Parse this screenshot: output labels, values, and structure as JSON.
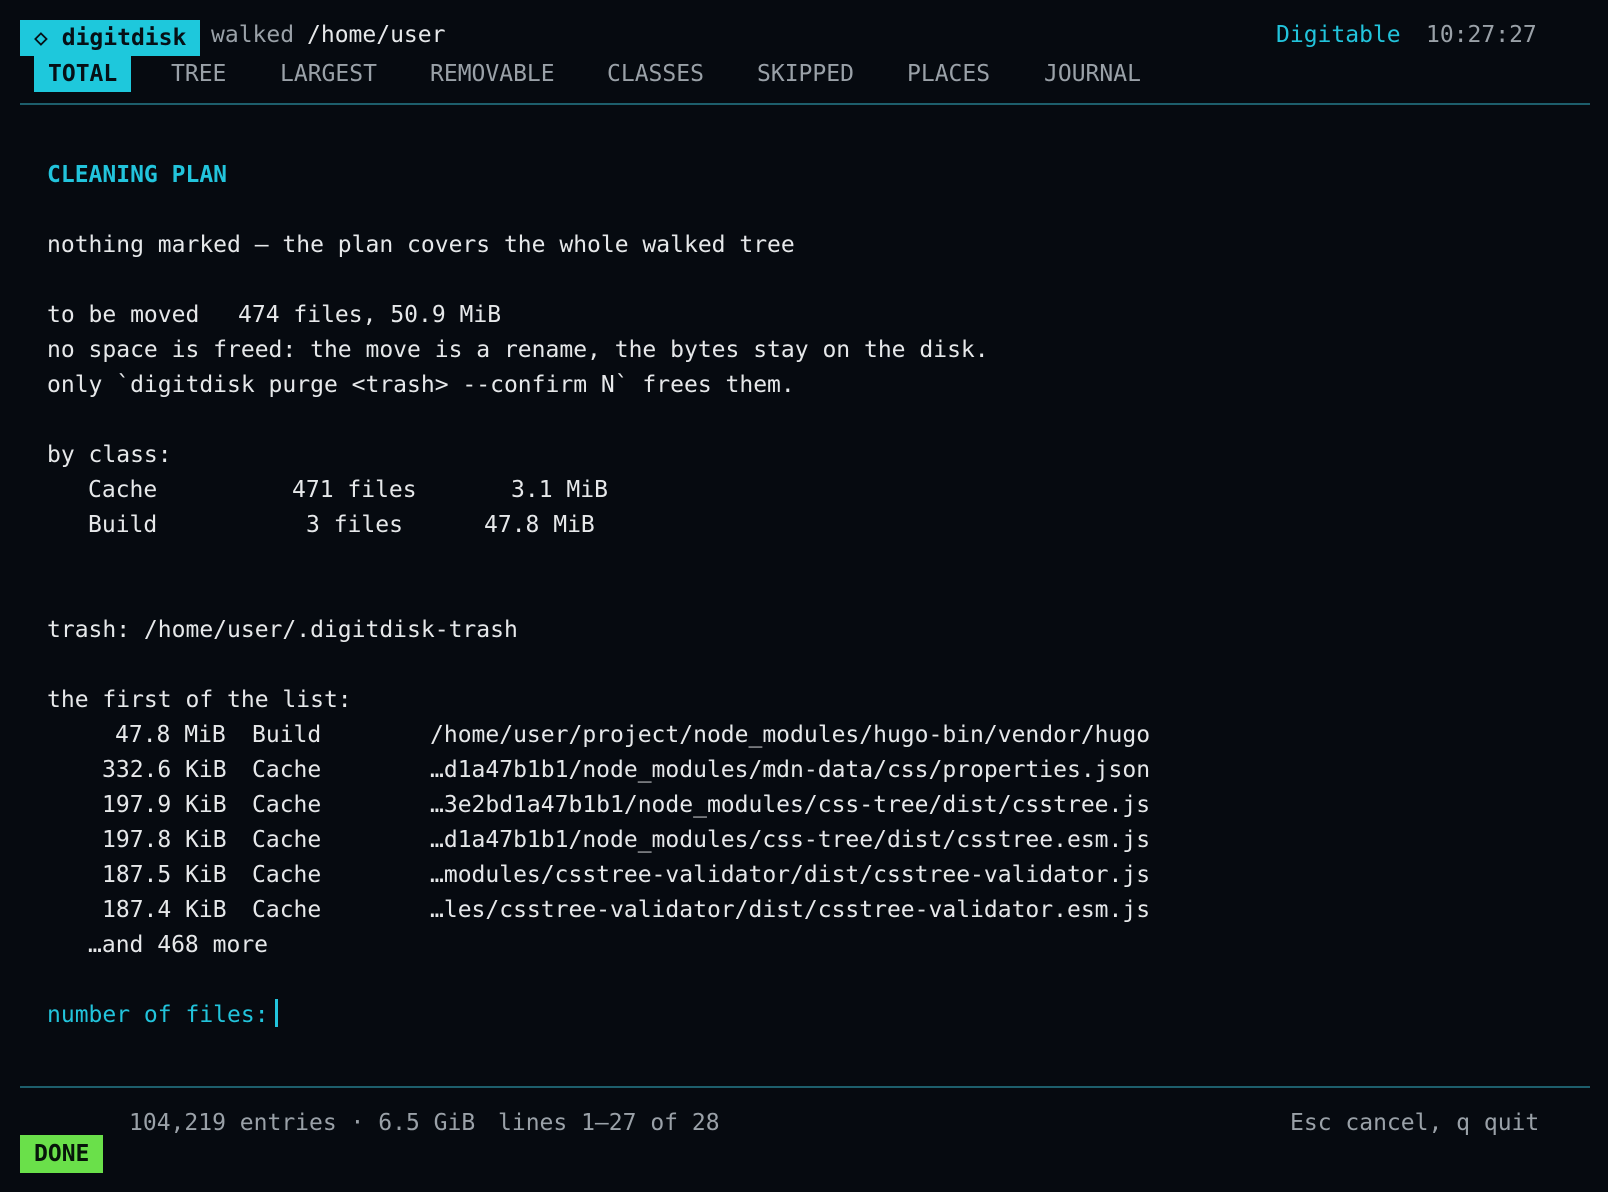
{
  "header": {
    "app_name": "digitdisk",
    "brand_icon": "diamond-icon",
    "walked_label": "walked",
    "walked_path": "/home/user",
    "theme": "Digitable",
    "clock": "10:27:27",
    "tabs": [
      "TOTAL",
      "TREE",
      "LARGEST",
      "REMOVABLE",
      "CLASSES",
      "SKIPPED",
      "PLACES",
      "JOURNAL"
    ],
    "active_tab": "TOTAL"
  },
  "plan": {
    "heading": "CLEANING PLAN",
    "nothing_marked": "nothing marked — the plan covers the whole walked tree",
    "to_be_moved_label": "to be moved",
    "to_be_moved_value": "474 files, 50.9 MiB",
    "note1": "no space is freed: the move is a rename, the bytes stay on the disk.",
    "note2": "only `digitdisk purge <trash> --confirm N` frees them.",
    "by_class_label": "by class:",
    "classes": [
      {
        "name": "Cache",
        "files": "471 files",
        "size": "3.1 MiB"
      },
      {
        "name": "Build",
        "files": "3 files",
        "size": "47.8 MiB"
      }
    ],
    "trash": "trash: /home/user/.digitdisk-trash",
    "first_label": "the first of the list:",
    "items": [
      {
        "size": "47.8 MiB",
        "cls": "Build",
        "path": "/home/user/project/node_modules/hugo-bin/vendor/hugo"
      },
      {
        "size": "332.6 KiB",
        "cls": "Cache",
        "path": "…d1a47b1b1/node_modules/mdn-data/css/properties.json"
      },
      {
        "size": "197.9 KiB",
        "cls": "Cache",
        "path": "…3e2bd1a47b1b1/node_modules/css-tree/dist/csstree.js"
      },
      {
        "size": "197.8 KiB",
        "cls": "Cache",
        "path": "…d1a47b1b1/node_modules/css-tree/dist/csstree.esm.js"
      },
      {
        "size": "187.5 KiB",
        "cls": "Cache",
        "path": "…modules/csstree-validator/dist/csstree-validator.js"
      },
      {
        "size": "187.4 KiB",
        "cls": "Cache",
        "path": "…les/csstree-validator/dist/csstree-validator.esm.js"
      }
    ],
    "more": "…and 468 more",
    "prompt_label": "number of files:",
    "prompt_value": ""
  },
  "footer": {
    "status": "DONE",
    "stats": "104,219 entries · 6.5 GiB",
    "lines": "lines 1–27 of 28",
    "help": "Esc cancel, q quit"
  },
  "colors": {
    "accent": "#1ec8dc",
    "done": "#6ae04a",
    "background": "#060a10"
  }
}
